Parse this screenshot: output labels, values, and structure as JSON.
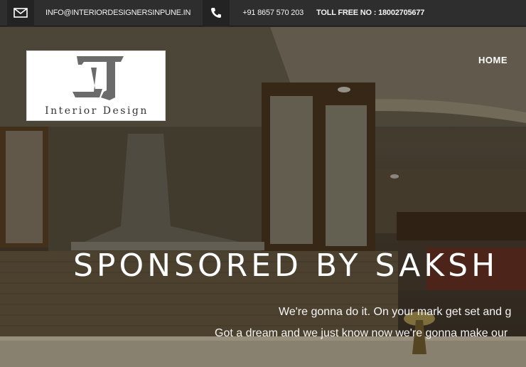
{
  "topbar": {
    "mail_icon": "envelope-icon",
    "email": "INFO@INTERIORDESIGNERSINPUNE.IN",
    "phone_icon": "phone-icon",
    "phone": "+91 8657 570 203",
    "tollfree": "TOLL FREE NO : 18002705677"
  },
  "logo": {
    "text": "Interior Design"
  },
  "nav": {
    "home": "HOME"
  },
  "hero": {
    "headline": "SPONSORED BY SAKSH",
    "line1": "We're gonna do it. On your mark get set and g",
    "line2": "Got a dream and we just know now we're gonna make our"
  },
  "colors": {
    "topbar_bg": "#2e2e2e",
    "icon_bg": "#232323",
    "text": "#ffffff",
    "logo_bg": "#ffffff",
    "logo_mark": "#6b6b6b"
  }
}
